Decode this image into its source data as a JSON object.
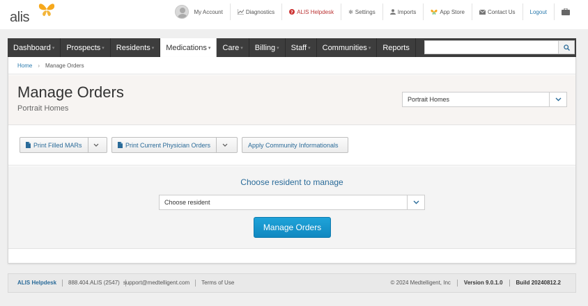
{
  "brand": {
    "logo_text": "alis",
    "accent": "#f6a81c"
  },
  "toplinks": [
    {
      "label": "My Account",
      "icon": "user-avatar-icon"
    },
    {
      "label": "Diagnostics",
      "icon": "chart-icon"
    },
    {
      "label": "ALIS Helpdesk",
      "icon": "help-icon",
      "color": "#b33333"
    },
    {
      "label": "Settings",
      "icon": "gear-icon"
    },
    {
      "label": "Imports",
      "icon": "upload-icon"
    },
    {
      "label": "App Store",
      "icon": "butterfly-icon"
    },
    {
      "label": "Contact Us",
      "icon": "envelope-icon"
    },
    {
      "label": "Logout",
      "icon": ""
    }
  ],
  "nav": {
    "items": [
      {
        "label": "Dashboard",
        "caret": true
      },
      {
        "label": "Prospects",
        "caret": true
      },
      {
        "label": "Residents",
        "caret": true
      },
      {
        "label": "Medications",
        "caret": true,
        "active": true
      },
      {
        "label": "Care",
        "caret": true
      },
      {
        "label": "Billing",
        "caret": true
      },
      {
        "label": "Staff",
        "caret": true
      },
      {
        "label": "Communities",
        "caret": true
      },
      {
        "label": "Reports",
        "caret": false
      }
    ],
    "search_placeholder": ""
  },
  "breadcrumb": {
    "home": "Home",
    "current": "Manage Orders"
  },
  "page": {
    "title": "Manage Orders",
    "subtitle": "Portrait Homes",
    "community_select": "Portrait Homes"
  },
  "actions": {
    "print_mars": "Print Filled MARs",
    "print_orders": "Print Current Physician Orders",
    "apply_informationals": "Apply Community Informationals"
  },
  "chooser": {
    "title": "Choose resident to manage",
    "select_value": "Choose resident",
    "submit": "Manage Orders"
  },
  "footer": {
    "helpdesk": "ALIS Helpdesk",
    "phone": "888.404.ALIS (2547)",
    "email": "support@medtelligent.com",
    "terms": "Terms of Use",
    "copyright": "© 2024 Medtelligent, Inc",
    "version": "Version 9.0.1.0",
    "build": "Build 20240812.2"
  }
}
